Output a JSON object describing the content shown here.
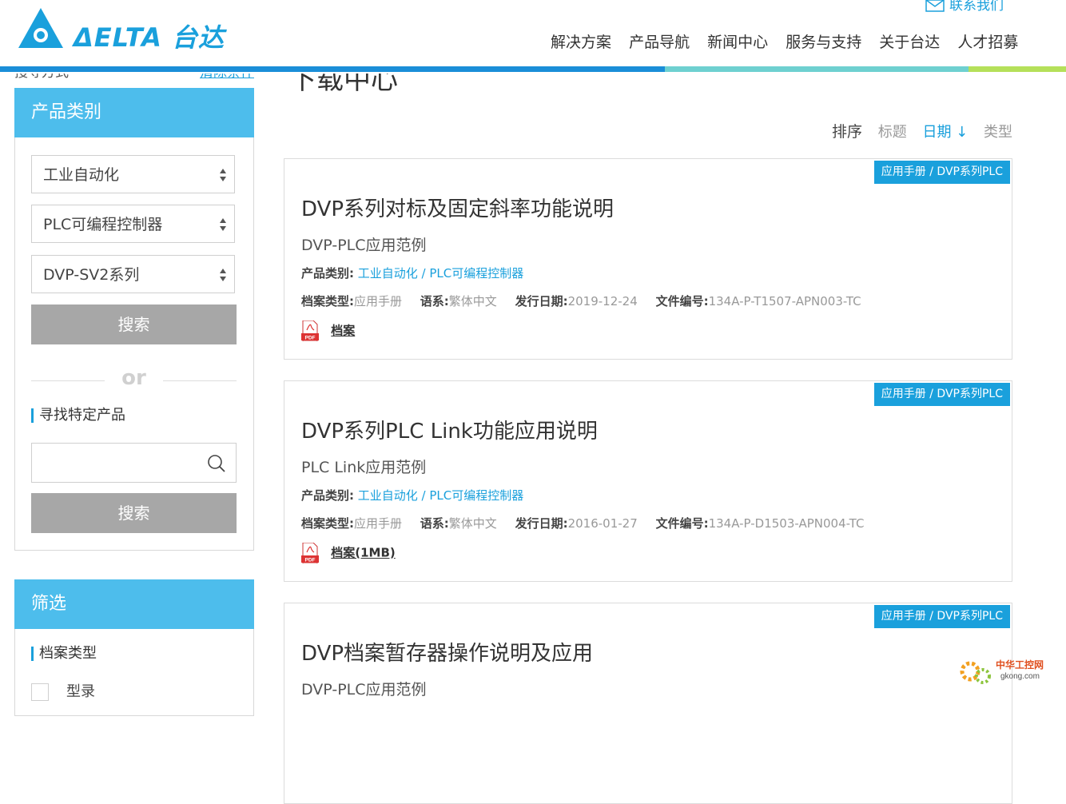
{
  "header": {
    "logo_text": "ΔELTA 台达",
    "contact": "联系我们",
    "nav": [
      "解决方案",
      "产品导航",
      "新闻中心",
      "服务与支持",
      "关于台达",
      "人才招募"
    ],
    "stripe_colors": [
      "#1a8ed8",
      "#6ed0d0",
      "#b5e05a"
    ]
  },
  "breadcrumb": {
    "left": "搜寻方式",
    "right": "清除条件"
  },
  "page_heading": "下载中心",
  "sidebar": {
    "category_title": "产品类别",
    "selects": [
      "工业自动化",
      "PLC可编程控制器",
      "DVP-SV2系列"
    ],
    "search_button": "搜索",
    "or_text": "or",
    "find_product_title": "寻找特定产品",
    "search_placeholder": "",
    "search_button_2": "搜索",
    "filter_title": "筛选",
    "filter_subtitle": "档案类型",
    "filter_options": [
      "型录"
    ]
  },
  "sort": {
    "label": "排序",
    "options": [
      "标题",
      "日期 ↓",
      "类型"
    ],
    "active": "日期 ↓"
  },
  "documents": [
    {
      "tag": "应用手册 / DVP系列PLC",
      "title": "DVP系列对标及固定斜率功能说明",
      "subtitle": "DVP-PLC应用范例",
      "category_label": "产品类别:",
      "category": "工业自动化 / PLC可编程控制器",
      "type_label": "档案类型:",
      "type": "应用手册",
      "lang_label": "语系:",
      "lang": "繁体中文",
      "date_label": "发行日期:",
      "date": "2019-12-24",
      "code_label": "文件编号:",
      "code": "134A-P-T1507-APN003-TC",
      "file": "档案"
    },
    {
      "tag": "应用手册 / DVP系列PLC",
      "title": "DVP系列PLC Link功能应用说明",
      "subtitle": "PLC Link应用范例",
      "category_label": "产品类别:",
      "category": "工业自动化 / PLC可编程控制器",
      "type_label": "档案类型:",
      "type": "应用手册",
      "lang_label": "语系:",
      "lang": "繁体中文",
      "date_label": "发行日期:",
      "date": "2016-01-27",
      "code_label": "文件编号:",
      "code": "134A-P-D1503-APN004-TC",
      "file": "档案(1MB)"
    },
    {
      "tag": "应用手册 / DVP系列PLC",
      "title": "DVP档案暂存器操作说明及应用",
      "subtitle": "DVP-PLC应用范例"
    }
  ],
  "watermark": {
    "line1": "中华工控网",
    "line2": "gkong.com"
  }
}
